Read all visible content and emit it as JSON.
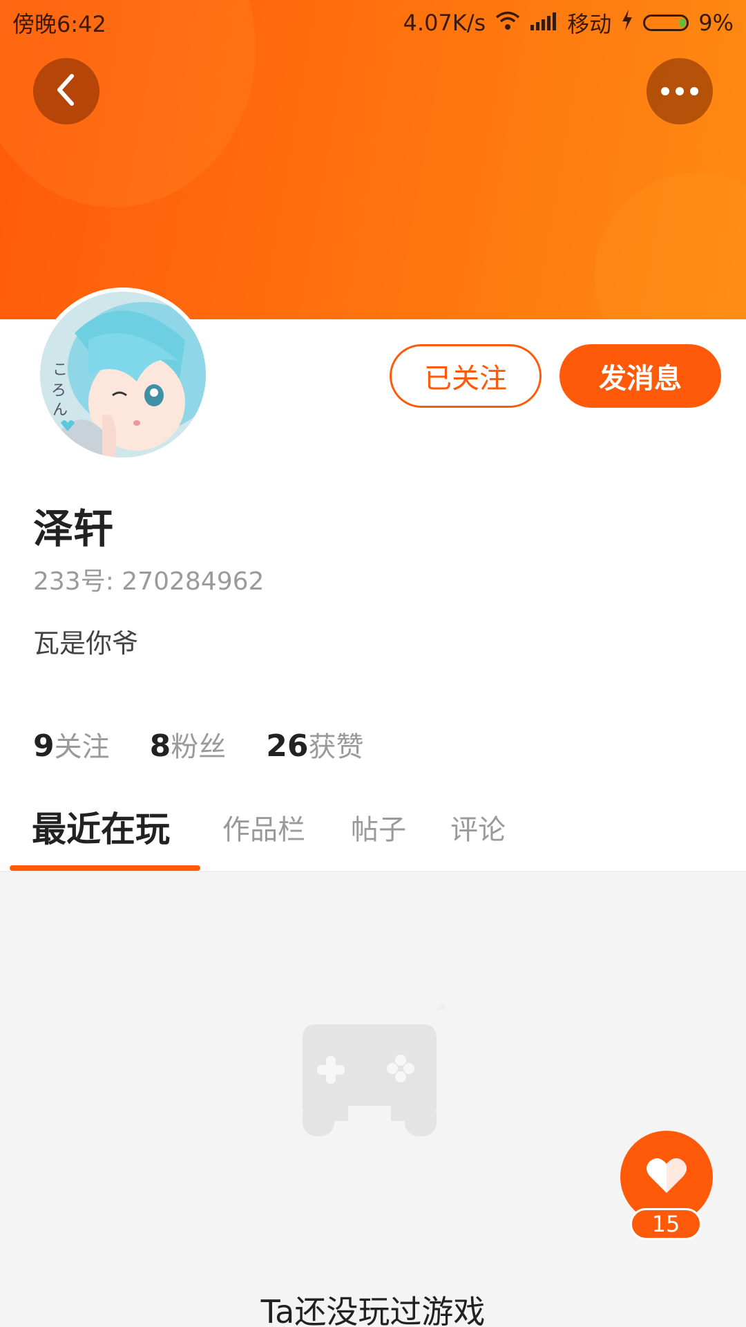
{
  "status_bar": {
    "time": "傍晚6:42",
    "network_speed": "4.07K/s",
    "carrier": "移动",
    "battery": "9%"
  },
  "header": {
    "back_icon": "chevron-left-icon",
    "more_icon": "more-dots-icon"
  },
  "profile": {
    "avatar_icon": "anime-avatar",
    "follow_label": "已关注",
    "message_label": "发消息",
    "name": "泽轩",
    "id_text": "233号: 270284962",
    "bio": "瓦是你爷"
  },
  "stats": [
    {
      "num": "9",
      "label": "关注"
    },
    {
      "num": "8",
      "label": "粉丝"
    },
    {
      "num": "26",
      "label": "获赞"
    }
  ],
  "tabs": [
    {
      "label": "最近在玩",
      "active": true
    },
    {
      "label": "作品栏",
      "active": false
    },
    {
      "label": "帖子",
      "active": false
    },
    {
      "label": "评论",
      "active": false
    }
  ],
  "empty_state": {
    "icon": "gamepad-icon",
    "text": "Ta还没玩过游戏"
  },
  "like": {
    "icon": "heart-icon",
    "count": "15"
  },
  "colors": {
    "accent": "#ff5a0a",
    "banner_start": "#ff5a0a",
    "banner_end": "#ff8a14"
  }
}
